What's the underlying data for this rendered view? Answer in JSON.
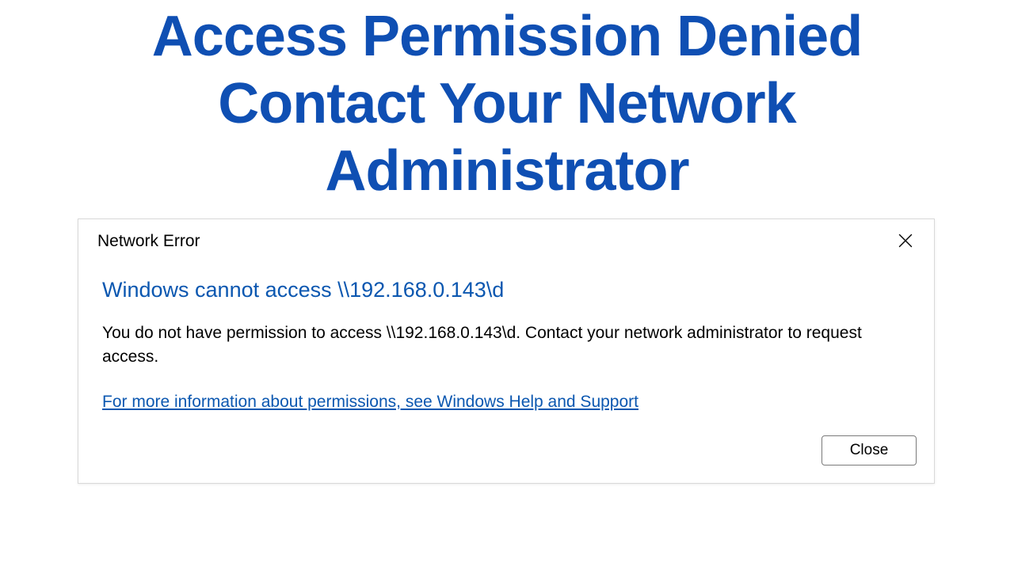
{
  "banner": {
    "line1": "Access Permission Denied",
    "line2": "Contact Your Network",
    "line3": "Administrator"
  },
  "dialog": {
    "title": "Network Error",
    "heading": "Windows cannot access \\\\192.168.0.143\\d",
    "message": "You do not have permission to access \\\\192.168.0.143\\d. Contact your network administrator to request access.",
    "help_link": "For more information about permissions, see Windows Help and Support",
    "close_label": "Close"
  }
}
